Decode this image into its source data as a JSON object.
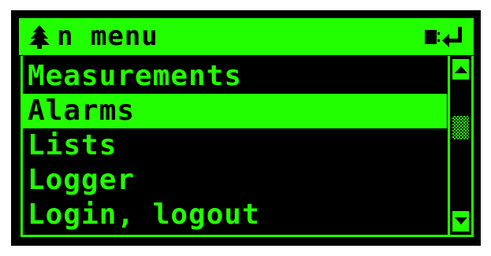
{
  "header": {
    "title": "n menu",
    "left_icon": "tree-icon",
    "right_icon": "keyboard-enter-icon"
  },
  "menu": {
    "items": [
      {
        "label": "Measurements",
        "selected": false
      },
      {
        "label": "Alarms",
        "selected": true
      },
      {
        "label": "Lists",
        "selected": false
      },
      {
        "label": "Logger",
        "selected": false
      },
      {
        "label": "Login, logout",
        "selected": false
      }
    ]
  },
  "scrollbar": {
    "up_icon": "arrow-up-icon",
    "down_icon": "arrow-down-icon",
    "position": 0.4
  },
  "colors": {
    "foreground": "#22ff00",
    "background": "#000000"
  }
}
